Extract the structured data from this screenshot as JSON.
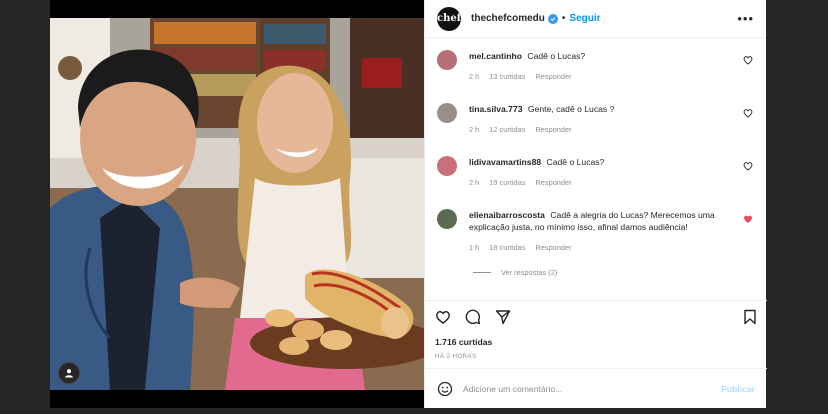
{
  "post": {
    "username": "thechefcomedu",
    "avatar_text": "chef",
    "follow_label": "Seguir",
    "more_label": "•••",
    "likes": "1.716 curtidas",
    "time_ago": "HÁ 2 HORAS"
  },
  "comments": [
    {
      "user": "mel.cantinho",
      "text": "Cadê o Lucas?",
      "time": "2 h",
      "likes": "13 curtidas",
      "reply": "Responder",
      "liked": false,
      "avatar_color": "#b7707a"
    },
    {
      "user": "tina.silva.773",
      "text": "Gente, cadê o Lucas ?",
      "time": "2 h",
      "likes": "12 curtidas",
      "reply": "Responder",
      "liked": false,
      "avatar_color": "#9a8f86"
    },
    {
      "user": "lidivavamartins88",
      "text": "Cadê o Lucas?",
      "time": "2 h",
      "likes": "19 curtidas",
      "reply": "Responder",
      "liked": false,
      "avatar_color": "#c9707a"
    },
    {
      "user": "elienaibarroscosta",
      "text": "Cadê a alegria do Lucas? Merecemos uma explicação justa, no mínimo isso, afinal damos audiência!",
      "time": "1 h",
      "likes": "18 curtidas",
      "reply": "Responder",
      "liked": true,
      "avatar_color": "#5b6b52"
    }
  ],
  "view_replies": "Ver respostas (2)",
  "add_comment": {
    "placeholder": "Adicione um comentário...",
    "publish_label": "Publicar"
  },
  "colors": {
    "accent": "#0095f6",
    "liked": "#ed4956",
    "muted": "#8e8e8e"
  }
}
